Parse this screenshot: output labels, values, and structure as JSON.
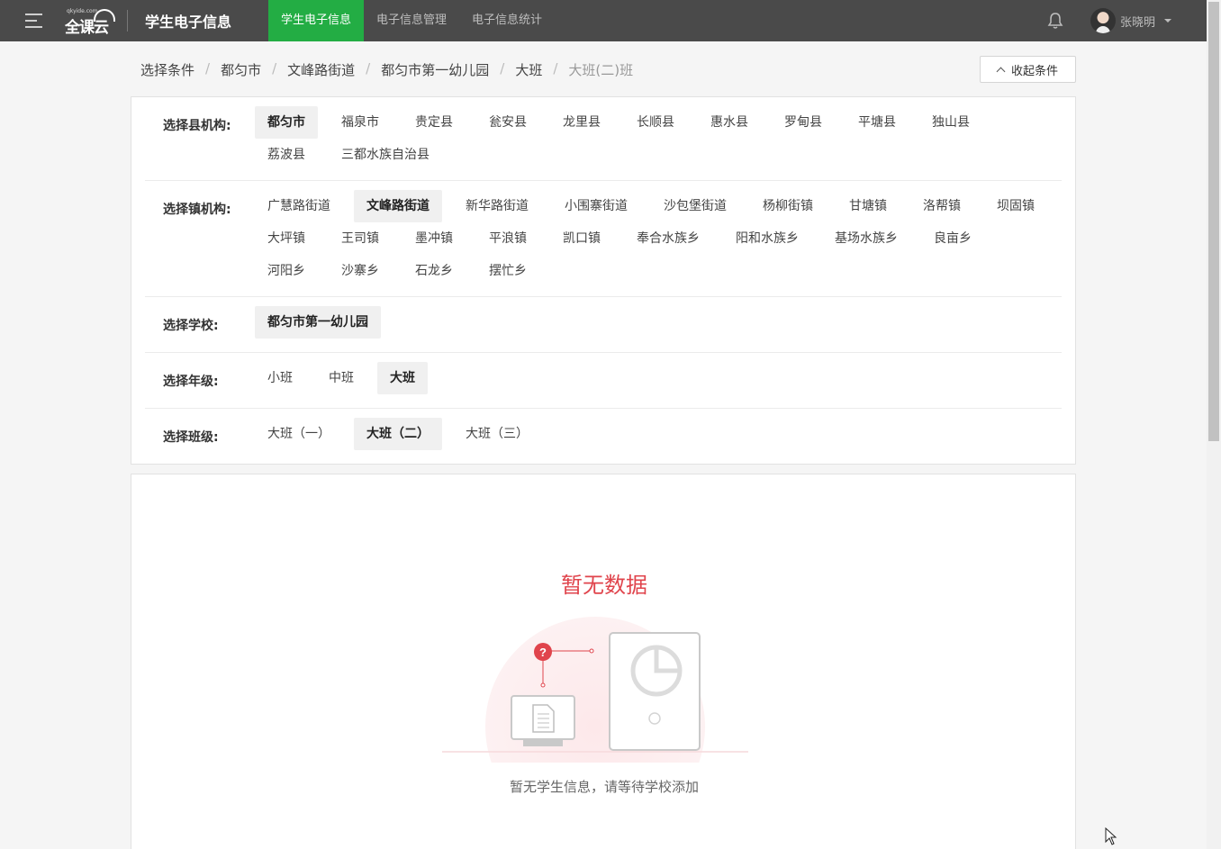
{
  "header": {
    "logo_text": "全课云",
    "logo_small": "qkyide.com",
    "app_title": "学生电子信息",
    "nav": [
      {
        "label": "学生电子信息",
        "active": true
      },
      {
        "label": "电子信息管理",
        "active": false
      },
      {
        "label": "电子信息统计",
        "active": false
      }
    ],
    "user_name": "张晓明",
    "accent_color": "#23ad44"
  },
  "breadcrumb": {
    "items": [
      "选择条件",
      "都匀市",
      "文峰路街道",
      "都匀市第一幼儿园",
      "大班",
      "大班(二)班"
    ],
    "separator": "/"
  },
  "collapse_button": "收起条件",
  "filters": {
    "county": {
      "label": "选择县机构:",
      "options": [
        "都匀市",
        "福泉市",
        "贵定县",
        "瓮安县",
        "龙里县",
        "长顺县",
        "惠水县",
        "罗甸县",
        "平塘县",
        "独山县",
        "荔波县",
        "三都水族自治县"
      ],
      "selected": "都匀市"
    },
    "town": {
      "label": "选择镇机构:",
      "options": [
        "广慧路街道",
        "文峰路街道",
        "新华路街道",
        "小围寨街道",
        "沙包堡街道",
        "杨柳街镇",
        "甘塘镇",
        "洛帮镇",
        "坝固镇",
        "大坪镇",
        "王司镇",
        "墨冲镇",
        "平浪镇",
        "凯口镇",
        "奉合水族乡",
        "阳和水族乡",
        "基场水族乡",
        "良亩乡",
        "河阳乡",
        "沙寨乡",
        "石龙乡",
        "摆忙乡"
      ],
      "selected": "文峰路街道"
    },
    "school": {
      "label": "选择学校:",
      "options": [
        "都匀市第一幼儿园"
      ],
      "selected": "都匀市第一幼儿园"
    },
    "grade": {
      "label": "选择年级:",
      "options": [
        "小班",
        "中班",
        "大班"
      ],
      "selected": "大班"
    },
    "class": {
      "label": "选择班级:",
      "options": [
        "大班（一）",
        "大班（二）",
        "大班（三）"
      ],
      "selected": "大班（二）"
    }
  },
  "empty_state": {
    "title": "暂无数据",
    "description": "暂无学生信息，请等待学校添加",
    "title_color": "#e0444c"
  }
}
